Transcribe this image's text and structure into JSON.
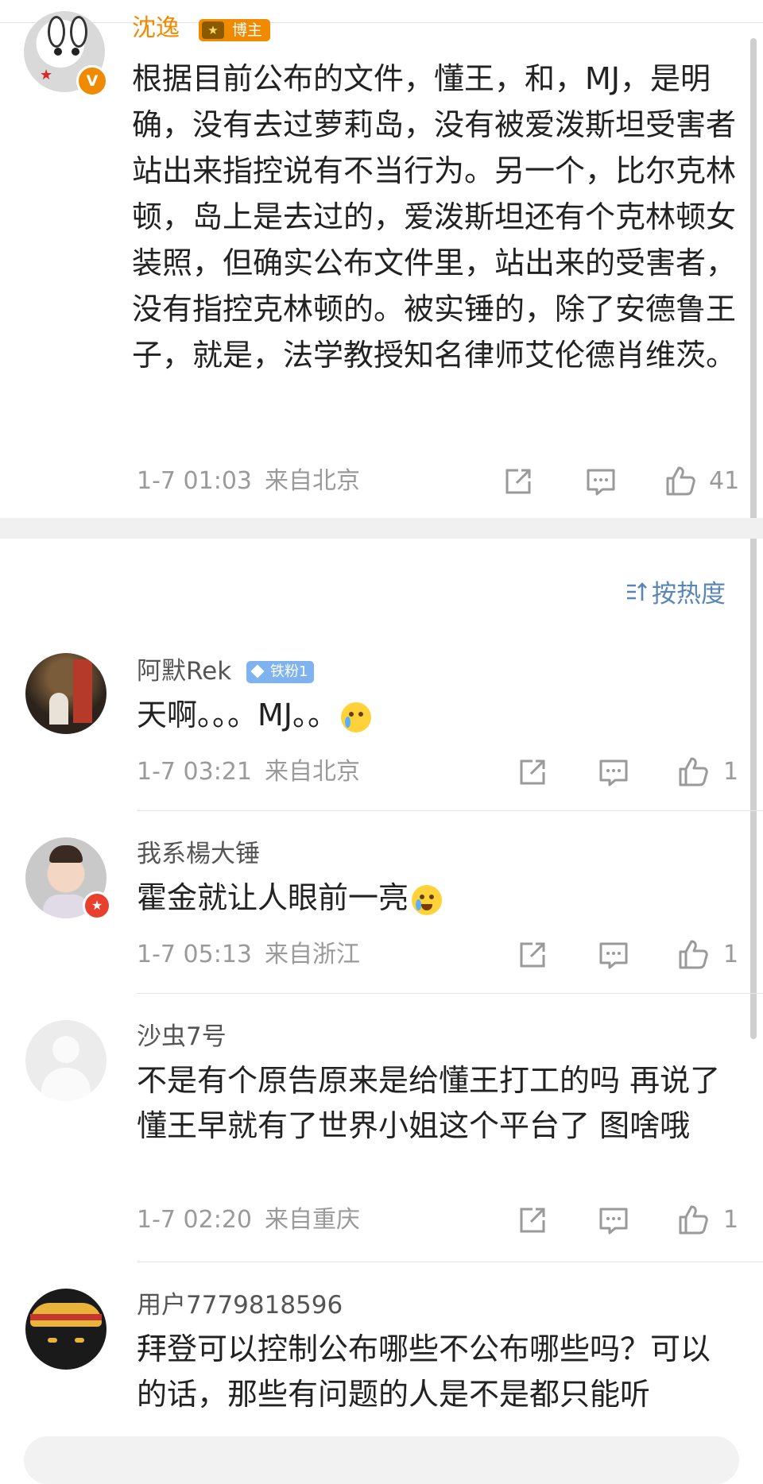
{
  "post": {
    "author": "沈逸",
    "verified_mark": "V",
    "badge_label": "博主",
    "badge_level": "★",
    "body": "根据目前公布的文件，懂王，和，MJ，是明确，没有去过萝莉岛，没有被爱泼斯坦受害者站出来指控说有不当行为。另一个，比尔克林顿，岛上是去过的，爱泼斯坦还有个克林顿女装照，但确实公布文件里，站出来的受害者，没有指控克林顿的。被实锤的，除了安德鲁王子，就是，法学教授知名律师艾伦德肖维茨。",
    "time": "1-7 01:03",
    "location": "来自北京",
    "likes": "41"
  },
  "sort_label": "按热度",
  "comments": [
    {
      "name": "阿默Rek",
      "badge": "铁粉1",
      "text": "天啊。。。MJ。。",
      "emoji": "crying-face-icon",
      "time": "1-7 03:21",
      "location": "来自北京",
      "likes": "1"
    },
    {
      "name": "我系楊大锤",
      "text": "霍金就让人眼前一亮",
      "emoji": "laughing-tears-icon",
      "time": "1-7 05:13",
      "location": "来自浙江",
      "likes": "1"
    },
    {
      "name": "沙虫7号",
      "text": "不是有个原告原来是给懂王打工的吗 再说了懂王早就有了世界小姐这个平台了 图啥哦",
      "time": "1-7 02:20",
      "location": "来自重庆",
      "likes": "1"
    },
    {
      "name": "用户7779818596",
      "text": "拜登可以控制公布哪些不公布哪些吗？可以的话，那些有问题的人是不是都只能听"
    }
  ],
  "colors": {
    "orange": "#f08a00",
    "link_blue": "#5a86b5",
    "meta_gray": "#9a9a9a"
  }
}
